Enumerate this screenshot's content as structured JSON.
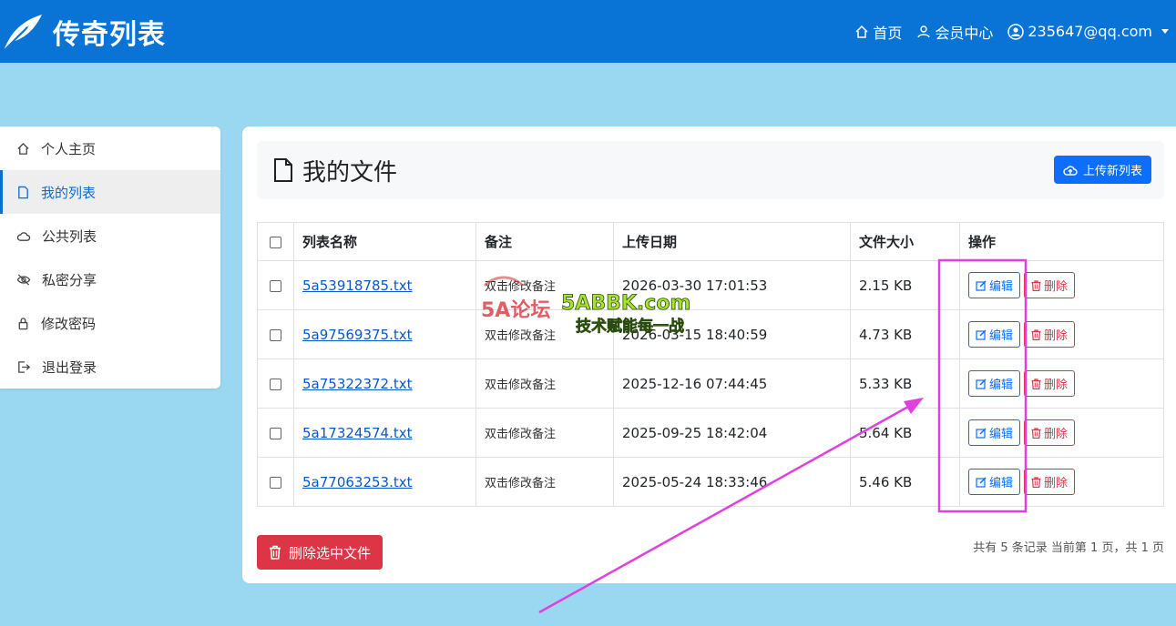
{
  "header": {
    "title": "传奇列表",
    "nav": {
      "home": "首页",
      "member": "会员中心",
      "account": "235647@qq.com"
    }
  },
  "sidebar": {
    "items": [
      {
        "label": "个人主页"
      },
      {
        "label": "我的列表"
      },
      {
        "label": "公共列表"
      },
      {
        "label": "私密分享"
      },
      {
        "label": "修改密码"
      },
      {
        "label": "退出登录"
      }
    ]
  },
  "main": {
    "title": "我的文件",
    "upload_label": "上传新列表",
    "columns": [
      "列表名称",
      "备注",
      "上传日期",
      "文件大小",
      "操作"
    ],
    "rows": [
      {
        "name": "5a53918785.txt",
        "note": "双击修改备注",
        "date": "2026-03-30 17:01:53",
        "size": "2.15 KB"
      },
      {
        "name": "5a97569375.txt",
        "note": "双击修改备注",
        "date": "2026-03-15 18:40:59",
        "size": "4.73 KB"
      },
      {
        "name": "5a75322372.txt",
        "note": "双击修改备注",
        "date": "2025-12-16 07:44:45",
        "size": "5.33 KB"
      },
      {
        "name": "5a17324574.txt",
        "note": "双击修改备注",
        "date": "2025-09-25 18:42:04",
        "size": "5.64 KB"
      },
      {
        "name": "5a77063253.txt",
        "note": "双击修改备注",
        "date": "2025-05-24 18:33:46",
        "size": "5.46 KB"
      }
    ],
    "edit_label": "编辑",
    "delete_label": "删除",
    "delete_selected_label": "删除选中文件",
    "pagination": "共有 5 条记录  当前第 1 页，共 1 页"
  },
  "watermark": {
    "logo": "5A论坛",
    "site": "5ABBK.com",
    "slogan": "技术赋能每一战"
  },
  "colors": {
    "header_bg": "#0a74d6",
    "page_bg": "#9ad7f0",
    "primary": "#0d6efd",
    "danger": "#dc3545",
    "annotation": "#e040e0"
  }
}
